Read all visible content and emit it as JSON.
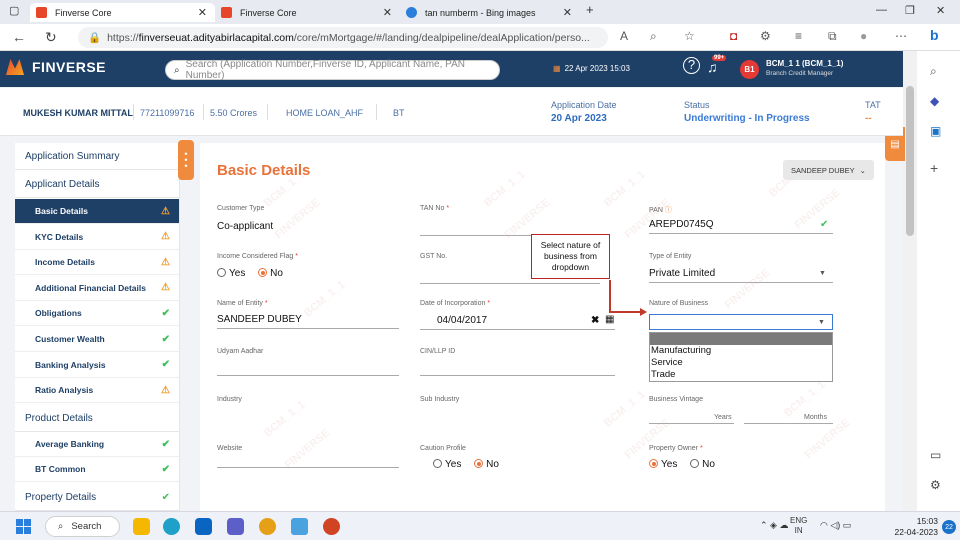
{
  "browser": {
    "tabs": [
      {
        "title": "Finverse Core",
        "active": true
      },
      {
        "title": "Finverse Core",
        "active": false
      },
      {
        "title": "tan numberm - Bing images",
        "active": false
      }
    ],
    "url_prefix": "https://",
    "url_domain": "finverseuat.adityabirlacapital.com",
    "url_path": "/core/mMortgage/#/landing/dealpipeline/dealApplication/perso...",
    "notification_badge": "99+"
  },
  "header": {
    "logo_text": "FINVERSE",
    "search_placeholder": "Search (Application Number,Finverse ID, Applicant Name, PAN Number)",
    "date": "22 Apr 2023 15:03",
    "avatar_text": "B1",
    "user_name": "BCM_1 1 (BCM_1_1)",
    "user_role": "Branch Credit Manager"
  },
  "deal": {
    "applicant": "MUKESH KUMAR MITTAL",
    "phone": "77211099716",
    "amount": "5.50 Crores",
    "product": "HOME LOAN_AHF",
    "type": "BT",
    "app_date_label": "Application Date",
    "app_date": "20 Apr 2023",
    "status_label": "Status",
    "status": "Underwriting - In Progress",
    "tat_label": "TAT",
    "tat": "--"
  },
  "nav": {
    "application_summary": "Application Summary",
    "applicant_details": "Applicant Details",
    "items": [
      {
        "label": "Basic Details",
        "status": "warn"
      },
      {
        "label": "KYC Details",
        "status": "warn"
      },
      {
        "label": "Income Details",
        "status": "warn"
      },
      {
        "label": "Additional Financial Details",
        "status": "warn"
      },
      {
        "label": "Obligations",
        "status": "ok"
      },
      {
        "label": "Customer Wealth",
        "status": "ok"
      },
      {
        "label": "Banking Analysis",
        "status": "ok"
      },
      {
        "label": "Ratio Analysis",
        "status": "warn"
      }
    ],
    "product_details": "Product Details",
    "product_items": [
      {
        "label": "Average Banking",
        "status": "ok"
      },
      {
        "label": "BT Common",
        "status": "ok"
      }
    ],
    "property_details": "Property Details"
  },
  "form": {
    "title": "Basic Details",
    "user_dropdown": "SANDEEP DUBEY",
    "watermark": "BCM_1_1",
    "watermark2": "FINVERSE",
    "customer_type_label": "Customer Type",
    "customer_type": "Co-applicant",
    "tan_label": "TAN No",
    "pan_label": "PAN",
    "pan_value": "AREPD0745Q",
    "income_flag_label": "Income Considered Flag",
    "yes": "Yes",
    "no": "No",
    "gst_label": "GST No.",
    "entity_type_label": "Type of Entity",
    "entity_type": "Private Limited",
    "entity_name_label": "Name of Entity",
    "entity_name": "SANDEEP DUBEY",
    "incorp_label": "Date of Incorporation",
    "incorp_date": "04/04/2017",
    "nature_label": "Nature of Business",
    "udyam_label": "Udyam Aadhar",
    "cin_label": "CIN/LLP ID",
    "industry_label": "Industry",
    "subindustry_label": "Sub Industry",
    "vintage_label": "Business Vintage",
    "years": "Years",
    "months": "Months",
    "website_label": "Website",
    "caution_label": "Caution Profile",
    "property_owner_label": "Property Owner"
  },
  "callout": {
    "text": "Select nature of business from dropdown"
  },
  "dropdown_options": [
    "Manufacturing",
    "Service",
    "Trade"
  ],
  "taskbar": {
    "search": "Search",
    "lang1": "ENG",
    "lang2": "IN",
    "time": "15:03",
    "date": "22-04-2023",
    "notif": "22"
  }
}
